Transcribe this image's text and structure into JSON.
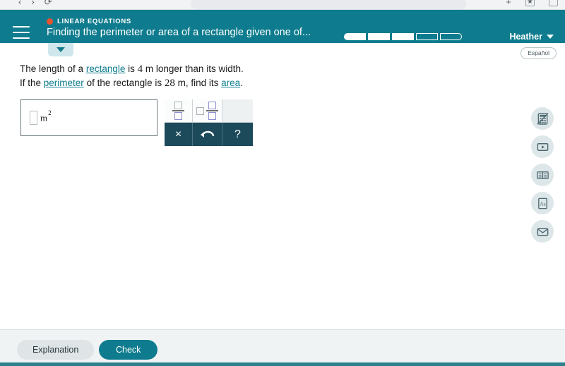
{
  "browser": {
    "back_icon": "back-arrow-icon",
    "forward_icon": "forward-arrow-icon",
    "reload_icon": "reload-icon",
    "address_value": "",
    "bookmark_icon": "star-icon",
    "window_icon": "window-icon",
    "plus_icon": "plus-icon"
  },
  "header": {
    "menu_icon": "hamburger-menu-icon",
    "topic": "LINEAR EQUATIONS",
    "topic_dot_color": "#e8522e",
    "title": "Finding the perimeter or area of a rectangle given one of...",
    "background_color": "#0e7c8e",
    "user_name": "Heather",
    "user_caret_icon": "chevron-down-icon",
    "progress": {
      "total": 5,
      "completed": 3,
      "segments": [
        "filled",
        "filled",
        "filled",
        "empty",
        "empty"
      ]
    }
  },
  "collapse_tab": {
    "icon": "triangle-down-icon"
  },
  "espanol_badge": {
    "label": "Español"
  },
  "problem": {
    "line1": {
      "part1": "The length of a ",
      "link1": "rectangle",
      "part2": " is ",
      "number1": "4",
      "part3": " m longer than its width."
    },
    "line2": {
      "part1": "If the ",
      "link1": "perimeter",
      "part2": " of the rectangle is ",
      "number1": "28",
      "part3": " m, find its ",
      "link2": "area",
      "part4": "."
    }
  },
  "answer": {
    "value": "",
    "placeholder_icon": "empty-input-box-icon",
    "unit_base": "m",
    "unit_exponent": "2"
  },
  "keypad": {
    "fraction_button": "fraction-template",
    "mixed_number_button": "mixed-number-template",
    "blank_slot": "",
    "clear_label": "×",
    "undo_label": "undo-arrow-icon",
    "help_label": "?"
  },
  "tools": [
    {
      "name": "calculator-disabled",
      "label": "Calculator (unavailable)"
    },
    {
      "name": "video",
      "label": "Video"
    },
    {
      "name": "reference-book",
      "label": "Reference"
    },
    {
      "name": "glossary",
      "label": "Glossary"
    },
    {
      "name": "message",
      "label": "Message"
    }
  ],
  "footer": {
    "explanation_label": "Explanation",
    "check_label": "Check",
    "check_color": "#0e7c8e"
  }
}
